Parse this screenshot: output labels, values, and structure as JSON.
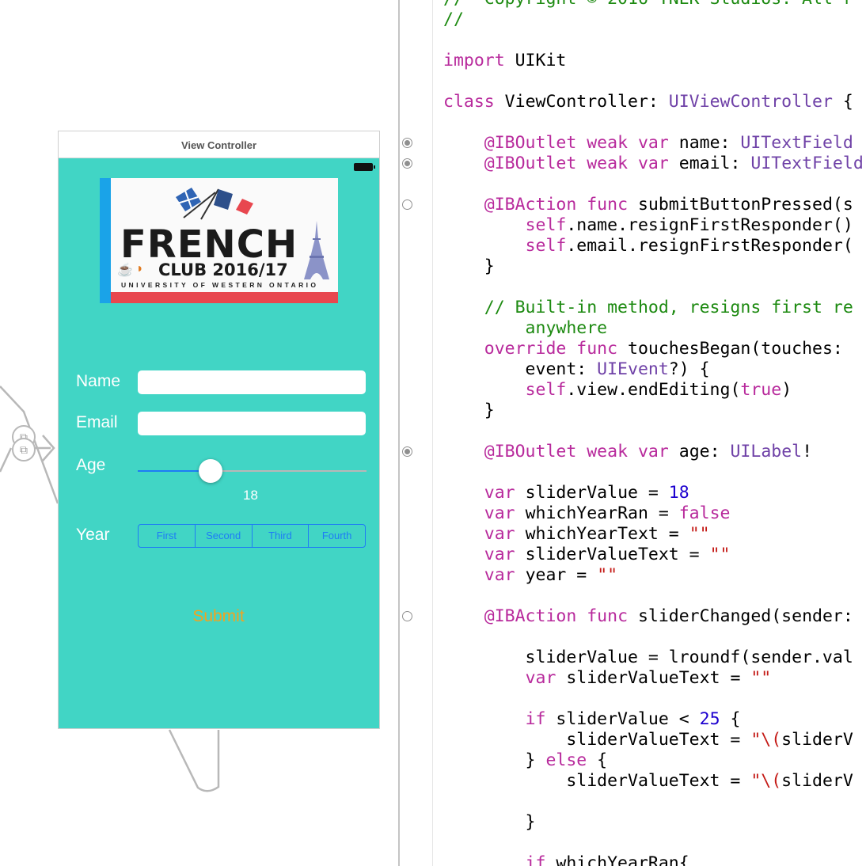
{
  "storyboard": {
    "scene_title": "View Controller",
    "logo": {
      "word": "FRENCH",
      "club": "CLUB 2016/17",
      "university": "UNIVERSITY OF WESTERN ONTARIO"
    },
    "form": {
      "name_label": "Name",
      "name_value": "",
      "email_label": "Email",
      "email_value": "",
      "age_label": "Age",
      "age_value": "18",
      "age_slider_fraction": 0.32,
      "year_label": "Year",
      "year_segments": [
        "First",
        "Second",
        "Third",
        "Fourth"
      ],
      "submit_label": "Submit"
    },
    "colors": {
      "background": "#41d5c5",
      "accent": "#1e7cf5",
      "submit": "#f2a31f"
    }
  },
  "code": {
    "gutter_markers": [
      {
        "line": 7,
        "connected": true
      },
      {
        "line": 8,
        "connected": true
      },
      {
        "line": 10,
        "connected": false
      },
      {
        "line": 22,
        "connected": true
      },
      {
        "line": 30,
        "connected": false
      }
    ],
    "lines": [
      [
        {
          "t": "//  Copyright © 2016 TNEK Studios. All r",
          "c": "cm"
        }
      ],
      [
        {
          "t": "//",
          "c": "cm"
        }
      ],
      [],
      [
        {
          "t": "import",
          "c": "kw"
        },
        {
          "t": " UIKit",
          "c": ""
        }
      ],
      [],
      [
        {
          "t": "class",
          "c": "kw"
        },
        {
          "t": " ViewController: ",
          "c": ""
        },
        {
          "t": "UIViewController",
          "c": "ty"
        },
        {
          "t": " {",
          "c": ""
        }
      ],
      [],
      [
        {
          "t": "    ",
          "c": ""
        },
        {
          "t": "@IBOutlet",
          "c": "kw"
        },
        {
          "t": " ",
          "c": ""
        },
        {
          "t": "weak",
          "c": "kw"
        },
        {
          "t": " ",
          "c": ""
        },
        {
          "t": "var",
          "c": "kw"
        },
        {
          "t": " name: ",
          "c": ""
        },
        {
          "t": "UITextField",
          "c": "ty"
        }
      ],
      [
        {
          "t": "    ",
          "c": ""
        },
        {
          "t": "@IBOutlet",
          "c": "kw"
        },
        {
          "t": " ",
          "c": ""
        },
        {
          "t": "weak",
          "c": "kw"
        },
        {
          "t": " ",
          "c": ""
        },
        {
          "t": "var",
          "c": "kw"
        },
        {
          "t": " email: ",
          "c": ""
        },
        {
          "t": "UITextField",
          "c": "ty"
        }
      ],
      [],
      [
        {
          "t": "    ",
          "c": ""
        },
        {
          "t": "@IBAction",
          "c": "kw"
        },
        {
          "t": " ",
          "c": ""
        },
        {
          "t": "func",
          "c": "kw"
        },
        {
          "t": " submitButtonPressed(s",
          "c": ""
        }
      ],
      [
        {
          "t": "        ",
          "c": ""
        },
        {
          "t": "self",
          "c": "kw"
        },
        {
          "t": ".name.resignFirstResponder()",
          "c": ""
        }
      ],
      [
        {
          "t": "        ",
          "c": ""
        },
        {
          "t": "self",
          "c": "kw"
        },
        {
          "t": ".email.resignFirstResponder(",
          "c": ""
        }
      ],
      [
        {
          "t": "    }",
          "c": ""
        }
      ],
      [],
      [
        {
          "t": "    // Built-in method, resigns first re",
          "c": "cm"
        }
      ],
      [
        {
          "t": "        anywhere",
          "c": "cm"
        }
      ],
      [
        {
          "t": "    ",
          "c": ""
        },
        {
          "t": "override",
          "c": "kw"
        },
        {
          "t": " ",
          "c": ""
        },
        {
          "t": "func",
          "c": "kw"
        },
        {
          "t": " touchesBegan(touches: ",
          "c": ""
        }
      ],
      [
        {
          "t": "        event: ",
          "c": ""
        },
        {
          "t": "UIEvent",
          "c": "ty"
        },
        {
          "t": "?) {",
          "c": ""
        }
      ],
      [
        {
          "t": "        ",
          "c": ""
        },
        {
          "t": "self",
          "c": "kw"
        },
        {
          "t": ".view.endEditing(",
          "c": ""
        },
        {
          "t": "true",
          "c": "kw"
        },
        {
          "t": ")",
          "c": ""
        }
      ],
      [
        {
          "t": "    }",
          "c": ""
        }
      ],
      [],
      [
        {
          "t": "    ",
          "c": ""
        },
        {
          "t": "@IBOutlet",
          "c": "kw"
        },
        {
          "t": " ",
          "c": ""
        },
        {
          "t": "weak",
          "c": "kw"
        },
        {
          "t": " ",
          "c": ""
        },
        {
          "t": "var",
          "c": "kw"
        },
        {
          "t": " age: ",
          "c": ""
        },
        {
          "t": "UILabel",
          "c": "ty"
        },
        {
          "t": "!",
          "c": ""
        }
      ],
      [],
      [
        {
          "t": "    ",
          "c": ""
        },
        {
          "t": "var",
          "c": "kw"
        },
        {
          "t": " sliderValue = ",
          "c": ""
        },
        {
          "t": "18",
          "c": "nu"
        }
      ],
      [
        {
          "t": "    ",
          "c": ""
        },
        {
          "t": "var",
          "c": "kw"
        },
        {
          "t": " whichYearRan = ",
          "c": ""
        },
        {
          "t": "false",
          "c": "kw"
        }
      ],
      [
        {
          "t": "    ",
          "c": ""
        },
        {
          "t": "var",
          "c": "kw"
        },
        {
          "t": " whichYearText = ",
          "c": ""
        },
        {
          "t": "\"\"",
          "c": "st"
        }
      ],
      [
        {
          "t": "    ",
          "c": ""
        },
        {
          "t": "var",
          "c": "kw"
        },
        {
          "t": " sliderValueText = ",
          "c": ""
        },
        {
          "t": "\"\"",
          "c": "st"
        }
      ],
      [
        {
          "t": "    ",
          "c": ""
        },
        {
          "t": "var",
          "c": "kw"
        },
        {
          "t": " year = ",
          "c": ""
        },
        {
          "t": "\"\"",
          "c": "st"
        }
      ],
      [],
      [
        {
          "t": "    ",
          "c": ""
        },
        {
          "t": "@IBAction",
          "c": "kw"
        },
        {
          "t": " ",
          "c": ""
        },
        {
          "t": "func",
          "c": "kw"
        },
        {
          "t": " sliderChanged(sender:",
          "c": ""
        }
      ],
      [],
      [
        {
          "t": "        sliderValue = lroundf(sender.val",
          "c": ""
        }
      ],
      [
        {
          "t": "        ",
          "c": ""
        },
        {
          "t": "var",
          "c": "kw"
        },
        {
          "t": " sliderValueText = ",
          "c": ""
        },
        {
          "t": "\"\"",
          "c": "st"
        }
      ],
      [],
      [
        {
          "t": "        ",
          "c": ""
        },
        {
          "t": "if",
          "c": "kw"
        },
        {
          "t": " sliderValue < ",
          "c": ""
        },
        {
          "t": "25",
          "c": "nu"
        },
        {
          "t": " {",
          "c": ""
        }
      ],
      [
        {
          "t": "            sliderValueText = ",
          "c": ""
        },
        {
          "t": "\"\\(",
          "c": "st"
        },
        {
          "t": "sliderV",
          "c": ""
        }
      ],
      [
        {
          "t": "        } ",
          "c": ""
        },
        {
          "t": "else",
          "c": "kw"
        },
        {
          "t": " {",
          "c": ""
        }
      ],
      [
        {
          "t": "            sliderValueText = ",
          "c": ""
        },
        {
          "t": "\"\\(",
          "c": "st"
        },
        {
          "t": "sliderV",
          "c": ""
        }
      ],
      [],
      [
        {
          "t": "        }",
          "c": ""
        }
      ],
      [],
      [
        {
          "t": "        ",
          "c": ""
        },
        {
          "t": "if",
          "c": "kw"
        },
        {
          "t": " whichYearRan{",
          "c": ""
        }
      ]
    ]
  }
}
